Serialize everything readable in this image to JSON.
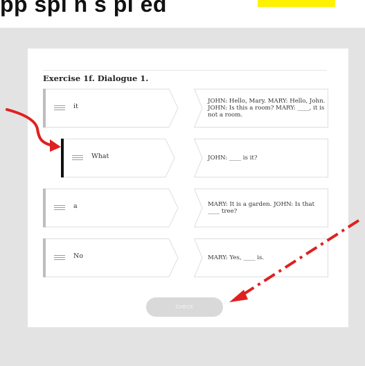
{
  "banner": {
    "text": "pp  spl  n   s pl ed"
  },
  "exercise": {
    "title": "Exercise 1f. Dialogue 1.",
    "pairs": [
      {
        "word": "it",
        "sentence": "JOHN: Hello, Mary. MARY: Hello, John. JOHN: Is this a room? MARY: ____, it is not a room."
      },
      {
        "word": "What",
        "sentence": "JOHN: ____ is it?"
      },
      {
        "word": "a",
        "sentence": "MARY: It is a garden. JOHN: Is that ____ tree?"
      },
      {
        "word": "No",
        "sentence": "MARY: Yes, ____ is."
      }
    ],
    "check_label": "CHECK"
  },
  "colors": {
    "page_bg": "#e3e3e3",
    "card_bg": "#ffffff",
    "tile_border": "#dedede",
    "tile_left_bar": "#bdbdbd",
    "active_left_bar": "#111111",
    "annotation_red": "#e02020",
    "banner_highlight": "#fff200",
    "button_bg": "#d9d9d9"
  },
  "icons": {
    "drag_handle": "drag-handle-icon",
    "arrow": "red-curved-arrow",
    "dashed_arrow": "red-dash-dot-arrow"
  }
}
